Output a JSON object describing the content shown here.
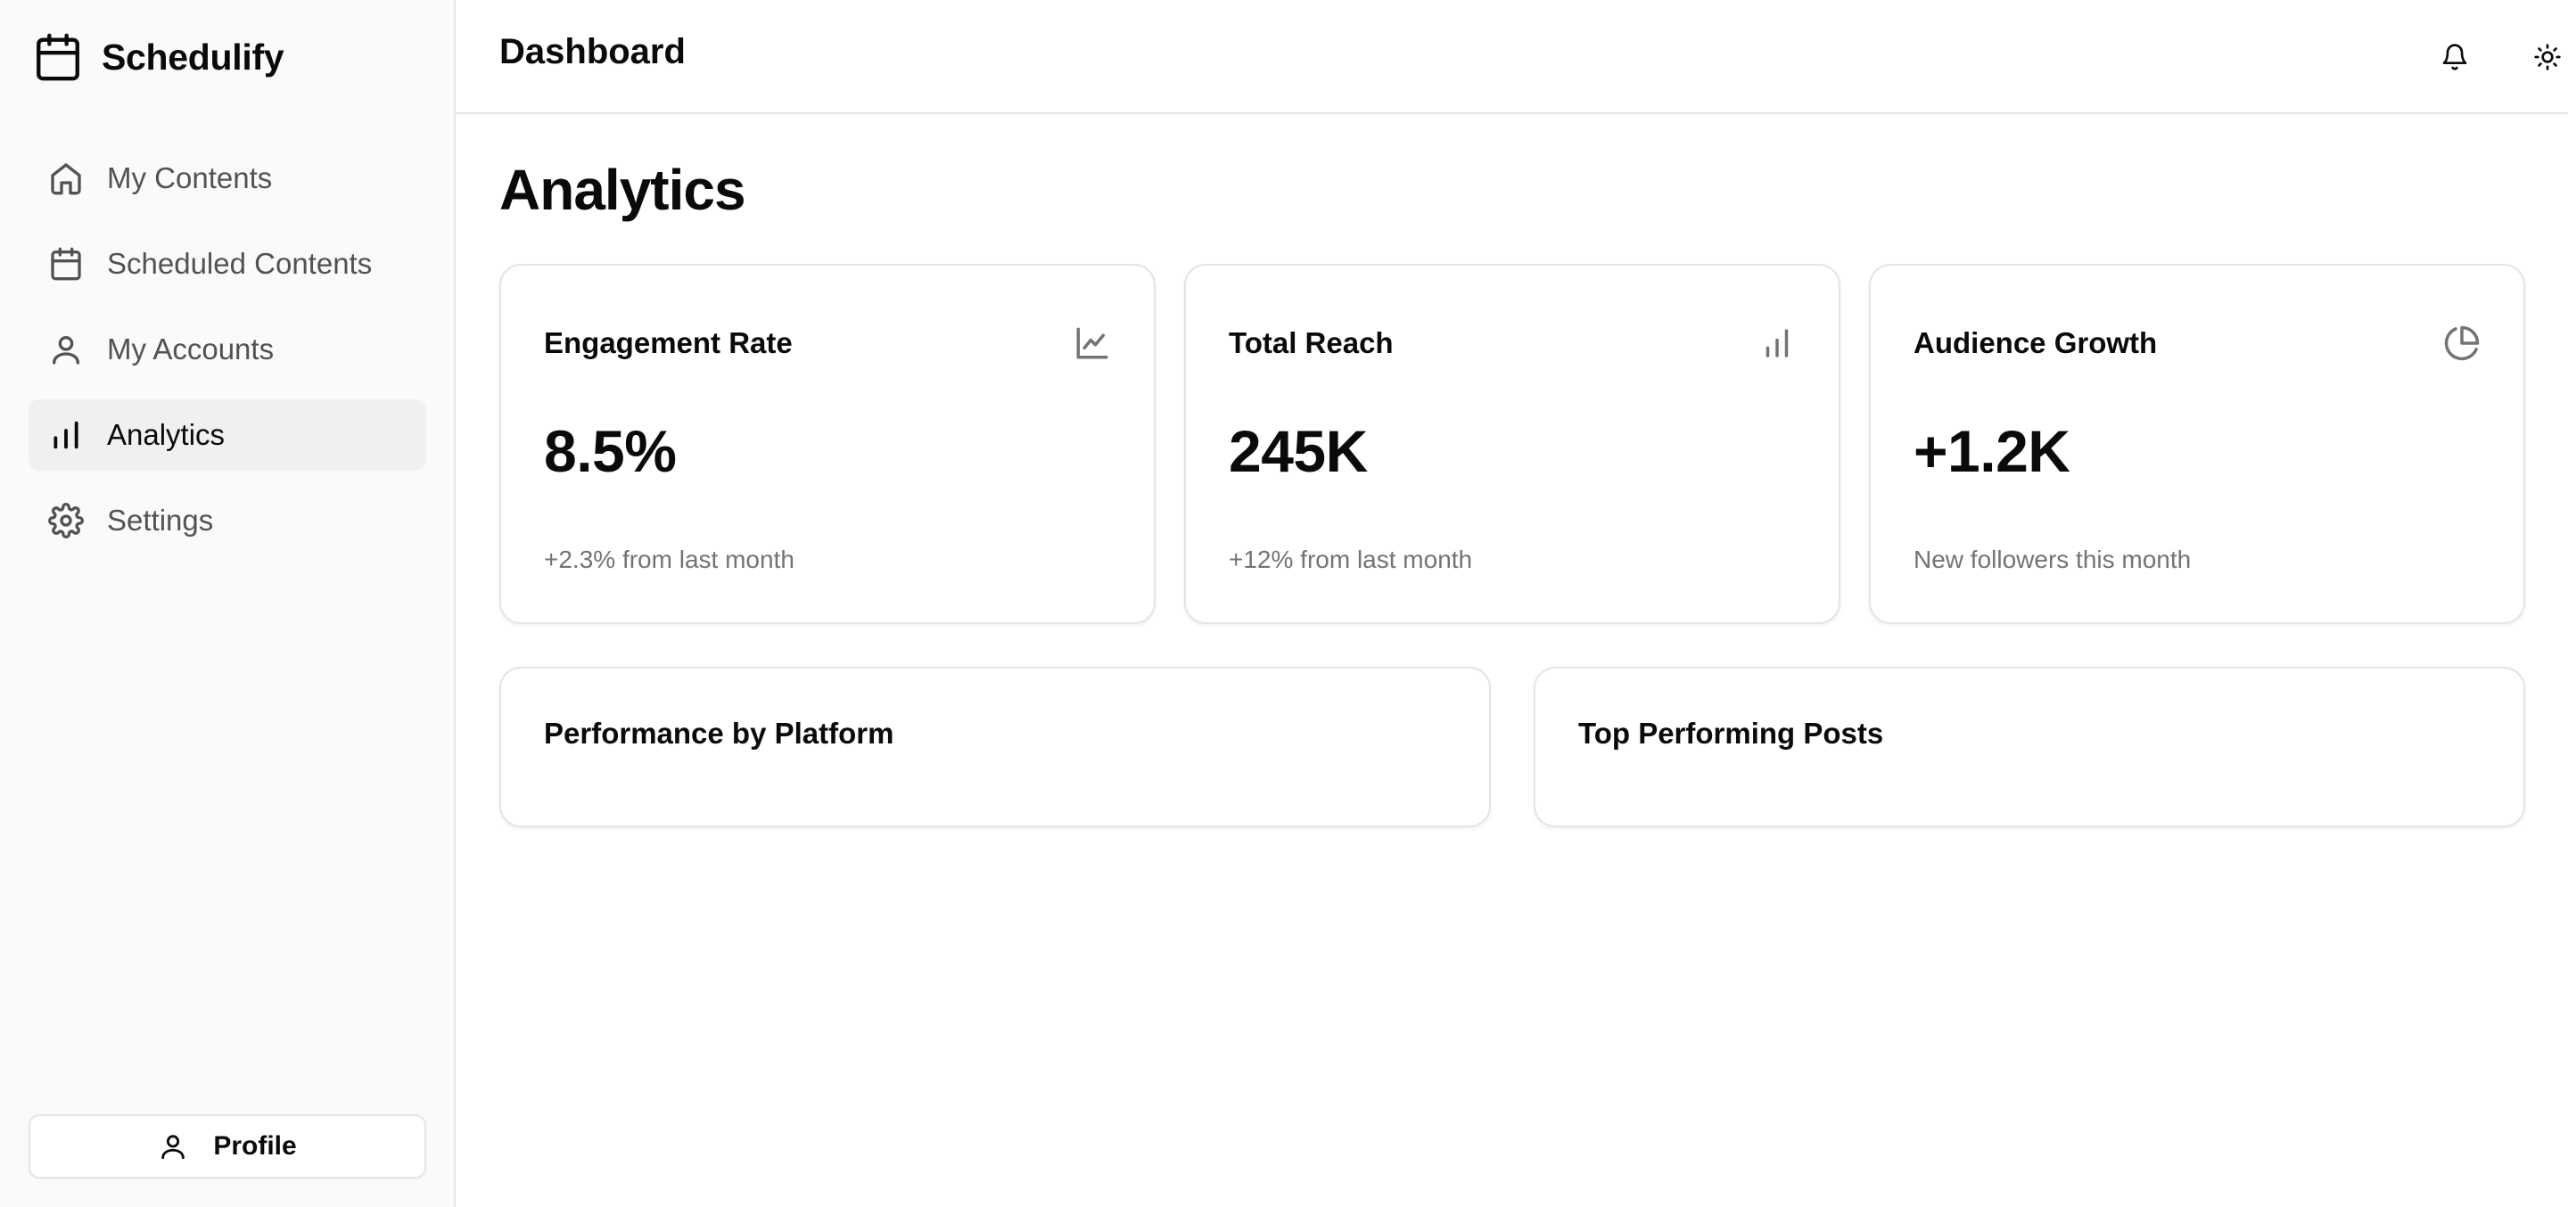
{
  "brand": {
    "name": "Schedulify"
  },
  "sidebar": {
    "items": [
      {
        "label": "My Contents",
        "icon": "home-icon",
        "active": false
      },
      {
        "label": "Scheduled Contents",
        "icon": "calendar-icon",
        "active": false
      },
      {
        "label": "My Accounts",
        "icon": "user-icon",
        "active": false
      },
      {
        "label": "Analytics",
        "icon": "bar-chart-icon",
        "active": true
      },
      {
        "label": "Settings",
        "icon": "gear-icon",
        "active": false
      }
    ],
    "profile_label": "Profile"
  },
  "header": {
    "title": "Dashboard",
    "icons": [
      "bell-icon",
      "sun-icon"
    ]
  },
  "main": {
    "title": "Analytics",
    "stats": [
      {
        "title": "Engagement Rate",
        "value": "8.5%",
        "sub": "+2.3% from last month",
        "icon": "line-chart-icon"
      },
      {
        "title": "Total Reach",
        "value": "245K",
        "sub": "+12% from last month",
        "icon": "bar-chart-icon"
      },
      {
        "title": "Audience Growth",
        "value": "+1.2K",
        "sub": "New followers this month",
        "icon": "pie-chart-icon"
      }
    ],
    "panels": [
      {
        "title": "Performance by Platform"
      },
      {
        "title": "Top Performing Posts"
      }
    ]
  },
  "colors": {
    "sidebar_bg": "#fafafa",
    "active_item_bg": "#f0f0f0",
    "border": "#e5e5e5",
    "muted_text": "#737373",
    "text": "#0a0a0a"
  }
}
